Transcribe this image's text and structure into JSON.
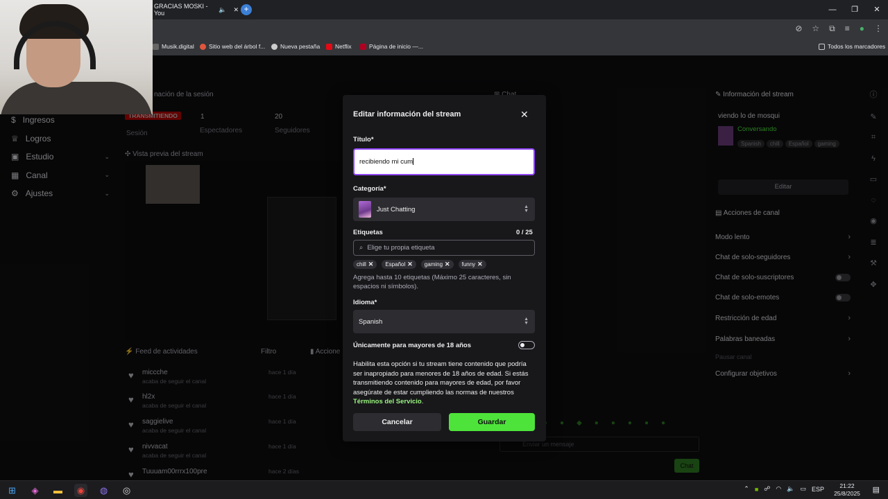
{
  "browser": {
    "tab_title": "GRACIAS MOSKI - You",
    "bookmarks": [
      "Musik.digital",
      "Sitio web del árbol f...",
      "Nueva pestaña",
      "Netflix",
      "Página de inicio —...",
      "Todos los marcadores"
    ]
  },
  "dashboard": {
    "session_header": "nación de la sesión",
    "live_badge": "TRANSMITIENDO",
    "session_label": "Sesión",
    "viewers_value": "1",
    "viewers_label": "Espectadores",
    "followers_value": "20",
    "followers_label": "Seguidores",
    "preview_header": "Vista previa del stream",
    "chat_header": "Chat",
    "nav": [
      {
        "label": "Ingresos",
        "chevron": false
      },
      {
        "label": "Logros",
        "chevron": false
      },
      {
        "label": "Estudio",
        "chevron": true
      },
      {
        "label": "Canal",
        "chevron": true
      },
      {
        "label": "Ajustes",
        "chevron": true
      }
    ],
    "feed": {
      "header": "Feed de actividades",
      "filter": "Filtro",
      "actions_header": "Accione",
      "items": [
        {
          "name": "miccche",
          "sub": "acaba de seguir el canal",
          "time": "hace 1 día"
        },
        {
          "name": "hl2x",
          "sub": "acaba de seguir el canal",
          "time": "hace 1 día"
        },
        {
          "name": "saggielive",
          "sub": "acaba de seguir el canal",
          "time": "hace 1 día"
        },
        {
          "name": "nivvacat",
          "sub": "acaba de seguir el canal",
          "time": "hace 1 día"
        },
        {
          "name": "Tuuuam00rrrx100pre",
          "sub": "",
          "time": "hace 2 días"
        }
      ]
    },
    "stream_info": {
      "header": "Información del stream",
      "title": "viendo lo de mosqui",
      "category": "Conversando",
      "tags": [
        "Spanish",
        "chill",
        "Español",
        "gaming"
      ],
      "edit": "Editar"
    },
    "channel_actions": {
      "header": "Acciones de canal",
      "items": [
        {
          "label": "Modo lento",
          "control": "chevron"
        },
        {
          "label": "Chat de solo-seguidores",
          "control": "chevron"
        },
        {
          "label": "Chat de solo-suscriptores",
          "control": "toggle"
        },
        {
          "label": "Chat de solo-emotes",
          "control": "toggle"
        },
        {
          "label": "Restricción de edad",
          "control": "chevron"
        },
        {
          "label": "Palabras baneadas",
          "control": "chevron"
        },
        {
          "label": "Pausar canal",
          "control": "none"
        },
        {
          "label": "Configurar objetivos",
          "control": "chevron"
        }
      ]
    },
    "chat_input_placeholder": "Enviar un mensaje",
    "chat_button": "Chat"
  },
  "modal": {
    "title": "Editar información del stream",
    "title_label": "Título*",
    "title_value": "recibiendo mi cum",
    "category_label": "Categoría*",
    "category_value": "Just Chatting",
    "tags_label": "Etiquetas",
    "tags_counter": "0 / 25",
    "tags_placeholder": "Elige tu propia etiqueta",
    "tags": [
      "chill",
      "Español",
      "gaming",
      "funny"
    ],
    "tags_helper": "Agrega hasta 10 etiquetas (Máximo 25 caracteres, sin espacios ni símbolos).",
    "language_label": "Idioma*",
    "language_value": "Spanish",
    "mature_label": "Únicamente para mayores de 18 años",
    "mature_desc": "Habilita esta opción si tu stream tiene contenido que podría ser inapropiado para menores de 18 años de edad. Si estás transmitiendo contenido para mayores de edad, por favor asegúrate de estar cumpliendo las normas de nuestros",
    "terms_link": "Términos del Servicio",
    "terms_suffix": ".",
    "cancel": "Cancelar",
    "save": "Guardar"
  },
  "taskbar": {
    "lang": "ESP",
    "time": "21:22",
    "date": "25/8/2025"
  }
}
